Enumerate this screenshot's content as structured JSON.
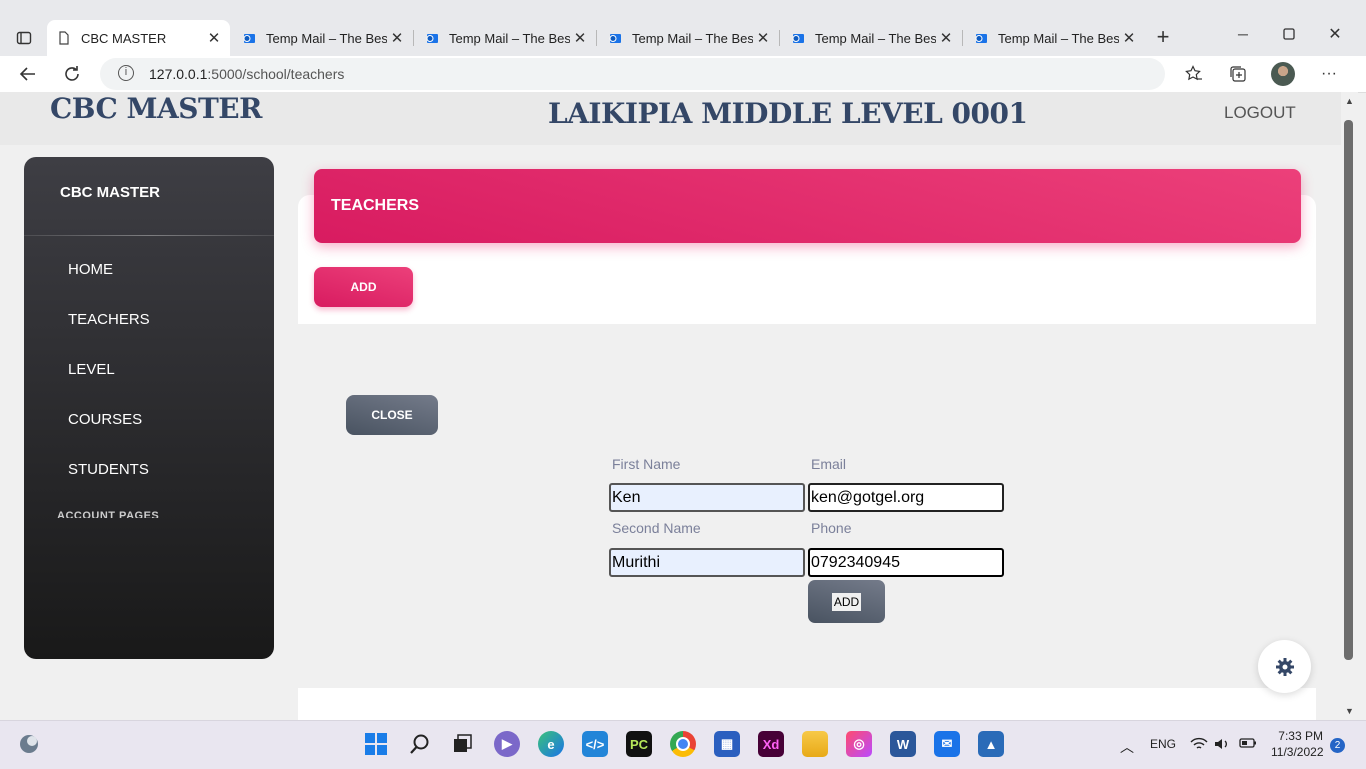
{
  "browser": {
    "tabs": [
      {
        "title": "CBC MASTER",
        "active": true
      },
      {
        "title": "Temp Mail – The Best",
        "active": false
      },
      {
        "title": "Temp Mail – The Best",
        "active": false
      },
      {
        "title": "Temp Mail – The Best",
        "active": false
      },
      {
        "title": "Temp Mail – The Best",
        "active": false
      },
      {
        "title": "Temp Mail – The Best",
        "active": false
      }
    ],
    "url_host": "127.0.0.1",
    "url_path": ":5000/school/teachers"
  },
  "topbar": {
    "brand": "CBC MASTER",
    "school_name": "LAIKIPIA MIDDLE LEVEL 0001",
    "logout": "LOGOUT"
  },
  "sidebar": {
    "title": "CBC MASTER",
    "items": [
      {
        "label": "HOME"
      },
      {
        "label": "TEACHERS"
      },
      {
        "label": "LEVEL"
      },
      {
        "label": "COURSES"
      },
      {
        "label": "STUDENTS"
      }
    ],
    "section": "ACCOUNT PAGES"
  },
  "main": {
    "header": "TEACHERS",
    "add_button": "ADD",
    "close_button": "CLOSE",
    "form": {
      "first_name_label": "First Name",
      "first_name_value": "Ken",
      "email_label": "Email",
      "email_value": "ken@gotgel.org",
      "second_name_label": "Second Name",
      "second_name_value": "Murithi",
      "phone_label": "Phone",
      "phone_value": "0792340945",
      "submit": "ADD"
    }
  },
  "taskbar": {
    "language": "ENG",
    "time": "7:33 PM",
    "date": "11/3/2022",
    "notifications": "2"
  }
}
